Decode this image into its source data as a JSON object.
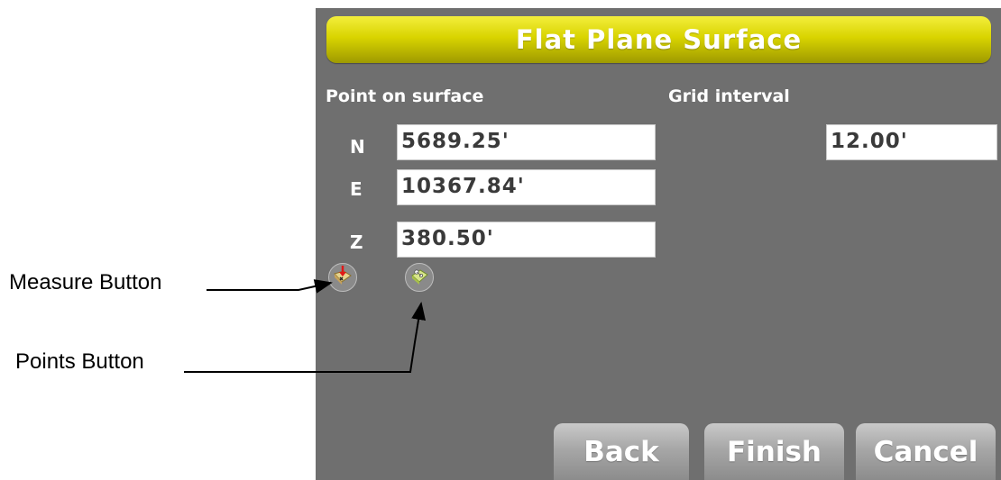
{
  "title": "Flat Plane Surface",
  "labels": {
    "point_on_surface": "Point on surface",
    "grid_interval": "Grid interval"
  },
  "fields": {
    "n": {
      "axis": "N",
      "value": "5689.25'"
    },
    "e": {
      "axis": "E",
      "value": "10367.84'"
    },
    "z": {
      "axis": "Z",
      "value": "380.50'"
    },
    "grid_interval": {
      "value": "12.00'"
    }
  },
  "icons": {
    "measure": "measure-icon",
    "points": "points-icon"
  },
  "buttons": {
    "back": "Back",
    "finish": "Finish",
    "cancel": "Cancel"
  },
  "annotations": {
    "measure": "Measure Button",
    "points": "Points Button"
  },
  "colors": {
    "title_bar": "#d9d400",
    "screen_bg": "#6f6f6f",
    "button_bg": "#a7a7a7"
  }
}
